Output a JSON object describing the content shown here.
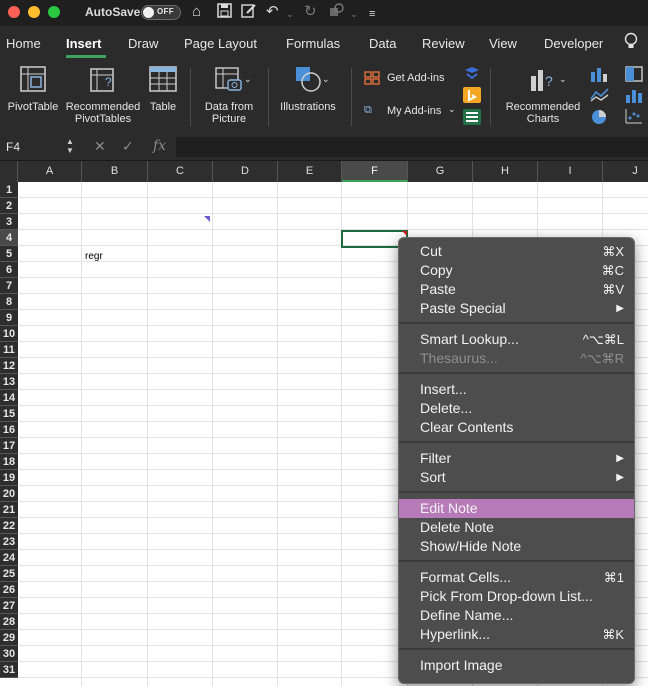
{
  "titlebar": {
    "autosave_label": "AutoSave",
    "autosave_state": "OFF",
    "buttons": [
      "close",
      "minimize",
      "zoom"
    ],
    "icons": [
      "home-icon",
      "save-icon",
      "edit-document-icon",
      "undo-icon",
      "redo-icon",
      "repeat-icon",
      "customize-toolbar-icon"
    ]
  },
  "tabs": [
    "Home",
    "Insert",
    "Draw",
    "Page Layout",
    "Formulas",
    "Data",
    "Review",
    "View",
    "Developer"
  ],
  "active_tab": "Insert",
  "ribbon": {
    "pivottable": "PivotTable",
    "recommended_pivottables_1": "Recommended",
    "recommended_pivottables_2": "PivotTables",
    "table": "Table",
    "data_from_picture_1": "Data from",
    "data_from_picture_2": "Picture",
    "illustrations": "Illustrations",
    "get_addins": "Get Add-ins",
    "my_addins": "My Add-ins",
    "recommended_charts_1": "Recommended",
    "recommended_charts_2": "Charts"
  },
  "formula_bar": {
    "name_box": "F4",
    "fx": "fx",
    "cancel_symbol": "✕",
    "enter_symbol": "✓",
    "value": ""
  },
  "sheet": {
    "columns": [
      "A",
      "B",
      "C",
      "D",
      "E",
      "F",
      "G",
      "H",
      "I",
      "J"
    ],
    "selected_column": "F",
    "rows": [
      1,
      2,
      3,
      4,
      5,
      6,
      7,
      8,
      9,
      10,
      11,
      12,
      13,
      14,
      15,
      16,
      17,
      18,
      19,
      20,
      21,
      22,
      23,
      24,
      25,
      26,
      27,
      28,
      29,
      30,
      31
    ],
    "selected_row": 4,
    "active_cell": "F4",
    "cells": {
      "B5": "regr"
    }
  },
  "context_menu": {
    "items": [
      {
        "label": "Cut",
        "shortcut": "⌘X",
        "disabled": false
      },
      {
        "label": "Copy",
        "shortcut": "⌘C",
        "disabled": false
      },
      {
        "label": "Paste",
        "shortcut": "⌘V",
        "disabled": false
      },
      {
        "label": "Paste Special",
        "shortcut": "▶",
        "disabled": false
      },
      {
        "label": "Smart Lookup...",
        "shortcut": "^⌥⌘L",
        "disabled": false
      },
      {
        "label": "Thesaurus...",
        "shortcut": "^⌥⌘R",
        "disabled": true
      },
      {
        "label": "Insert...",
        "shortcut": "",
        "disabled": false
      },
      {
        "label": "Delete...",
        "shortcut": "",
        "disabled": false
      },
      {
        "label": "Clear Contents",
        "shortcut": "",
        "disabled": false
      },
      {
        "label": "Filter",
        "shortcut": "▶",
        "disabled": false
      },
      {
        "label": "Sort",
        "shortcut": "▶",
        "disabled": false
      },
      {
        "label": "Edit Note",
        "shortcut": "",
        "disabled": false,
        "highlighted": true
      },
      {
        "label": "Delete Note",
        "shortcut": "",
        "disabled": false
      },
      {
        "label": "Show/Hide Note",
        "shortcut": "",
        "disabled": false
      },
      {
        "label": "Format Cells...",
        "shortcut": "⌘1",
        "disabled": false
      },
      {
        "label": "Pick From Drop-down List...",
        "shortcut": "",
        "disabled": false
      },
      {
        "label": "Define Name...",
        "shortcut": "",
        "disabled": false
      },
      {
        "label": "Hyperlink...",
        "shortcut": "⌘K",
        "disabled": false
      },
      {
        "label": "Import Image",
        "shortcut": "",
        "disabled": false
      }
    ]
  },
  "colors": {
    "accent": "#3fa25b",
    "menu_highlight": "#b67ab8",
    "note_marker": "#6a5acd",
    "active_cell_border": "#1e6b3e"
  }
}
